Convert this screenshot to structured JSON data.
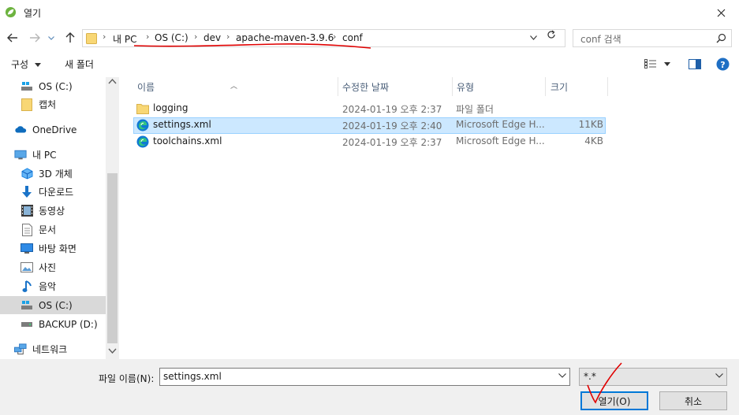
{
  "window": {
    "title": "열기"
  },
  "address": {
    "crumbs": [
      "내 PC",
      "OS (C:)",
      "dev",
      "apache-maven-3.9.6",
      "conf"
    ]
  },
  "search": {
    "placeholder": "conf 검색"
  },
  "toolbar": {
    "organize": "구성",
    "new_folder": "새 폴더"
  },
  "sidebar": {
    "items": [
      {
        "label": "OS (C:)",
        "icon": "drive-icon"
      },
      {
        "label": "캡처",
        "icon": "folder-icon"
      },
      {
        "label": "OneDrive",
        "icon": "onedrive-icon"
      },
      {
        "label": "내 PC",
        "icon": "pc-icon"
      },
      {
        "label": "3D 개체",
        "icon": "cube-icon"
      },
      {
        "label": "다운로드",
        "icon": "download-icon"
      },
      {
        "label": "동영상",
        "icon": "video-icon"
      },
      {
        "label": "문서",
        "icon": "document-icon"
      },
      {
        "label": "바탕 화면",
        "icon": "desktop-icon"
      },
      {
        "label": "사진",
        "icon": "pictures-icon"
      },
      {
        "label": "음악",
        "icon": "music-icon"
      },
      {
        "label": "OS (C:)",
        "icon": "drive-icon"
      },
      {
        "label": "BACKUP (D:)",
        "icon": "drive-icon"
      },
      {
        "label": "네트워크",
        "icon": "network-icon"
      }
    ]
  },
  "columns": {
    "name": "이름",
    "modified": "수정한 날짜",
    "type": "유형",
    "size": "크기"
  },
  "files": [
    {
      "name": "logging",
      "modified": "2024-01-19 오후 2:37",
      "type": "파일 폴더",
      "size": "",
      "icon": "folder-icon"
    },
    {
      "name": "settings.xml",
      "modified": "2024-01-19 오후 2:40",
      "type": "Microsoft Edge H...",
      "size": "11KB",
      "icon": "edge-icon"
    },
    {
      "name": "toolchains.xml",
      "modified": "2024-01-19 오후 2:37",
      "type": "Microsoft Edge H...",
      "size": "4KB",
      "icon": "edge-icon"
    }
  ],
  "footer": {
    "filename_label": "파일 이름(N):",
    "filename_value": "settings.xml",
    "filter_value": "*.*",
    "open_label": "열기(O)",
    "cancel_label": "취소"
  },
  "colors": {
    "accent": "#0078d7",
    "selection": "#cce8ff",
    "annotation": "#e00000",
    "folder": "#f8d775"
  }
}
